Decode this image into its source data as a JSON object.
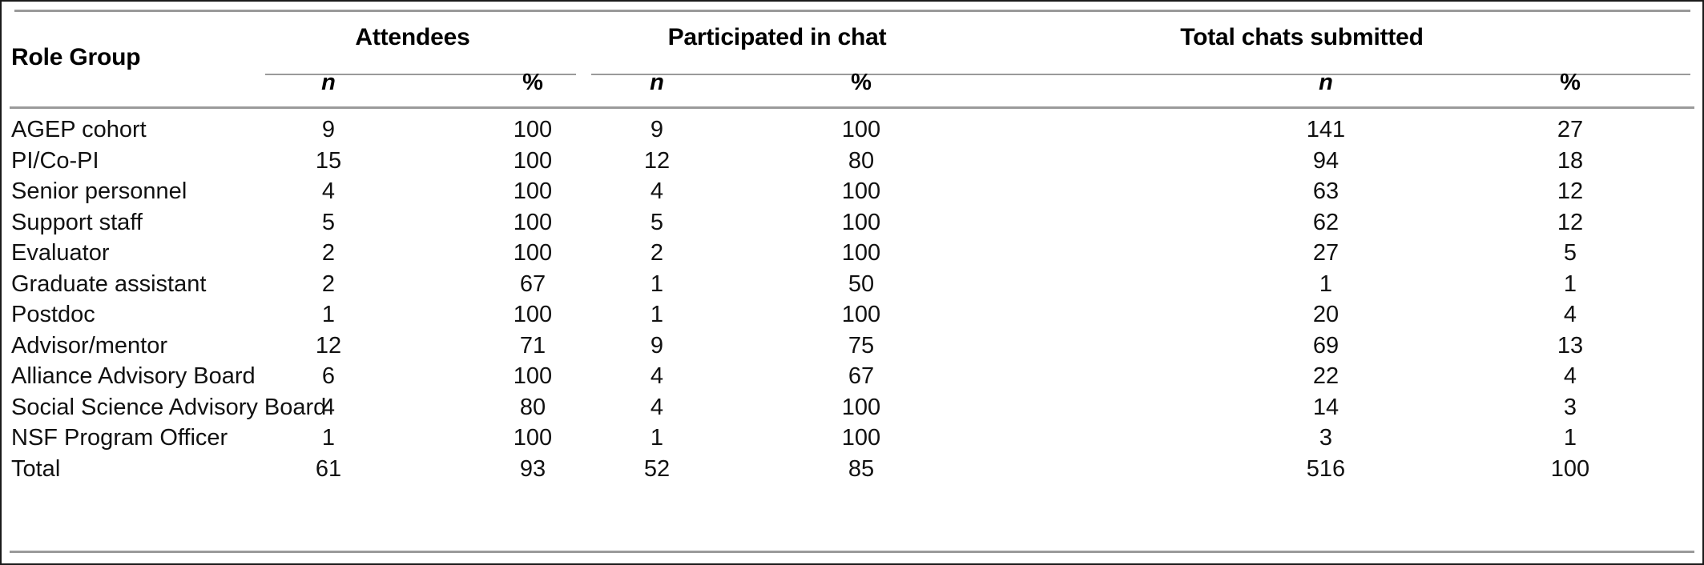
{
  "table": {
    "row_header_label": "Role Group",
    "column_groups": [
      {
        "title": "Attendees",
        "subcolumns": [
          "n",
          "%"
        ]
      },
      {
        "title": "Participated in chat",
        "subcolumns": [
          "n",
          "%"
        ]
      },
      {
        "title": "Total chats submitted",
        "subcolumns": [
          "n",
          "%"
        ]
      }
    ],
    "rows": [
      {
        "label": "AGEP cohort",
        "attendees_n": "9",
        "attendees_pct": "100",
        "chat_n": "9",
        "chat_pct": "100",
        "chats_n": "141",
        "chats_pct": "27"
      },
      {
        "label": "PI/Co-PI",
        "attendees_n": "15",
        "attendees_pct": "100",
        "chat_n": "12",
        "chat_pct": "80",
        "chats_n": "94",
        "chats_pct": "18"
      },
      {
        "label": "Senior personnel",
        "attendees_n": "4",
        "attendees_pct": "100",
        "chat_n": "4",
        "chat_pct": "100",
        "chats_n": "63",
        "chats_pct": "12"
      },
      {
        "label": "Support staff",
        "attendees_n": "5",
        "attendees_pct": "100",
        "chat_n": "5",
        "chat_pct": "100",
        "chats_n": "62",
        "chats_pct": "12"
      },
      {
        "label": "Evaluator",
        "attendees_n": "2",
        "attendees_pct": "100",
        "chat_n": "2",
        "chat_pct": "100",
        "chats_n": "27",
        "chats_pct": "5"
      },
      {
        "label": "Graduate assistant",
        "attendees_n": "2",
        "attendees_pct": "67",
        "chat_n": "1",
        "chat_pct": "50",
        "chats_n": "1",
        "chats_pct": "1"
      },
      {
        "label": "Postdoc",
        "attendees_n": "1",
        "attendees_pct": "100",
        "chat_n": "1",
        "chat_pct": "100",
        "chats_n": "20",
        "chats_pct": "4"
      },
      {
        "label": "Advisor/mentor",
        "attendees_n": "12",
        "attendees_pct": "71",
        "chat_n": "9",
        "chat_pct": "75",
        "chats_n": "69",
        "chats_pct": "13"
      },
      {
        "label": "Alliance Advisory Board",
        "attendees_n": "6",
        "attendees_pct": "100",
        "chat_n": "4",
        "chat_pct": "67",
        "chats_n": "22",
        "chats_pct": "4"
      },
      {
        "label": "Social Science Advisory Board",
        "attendees_n": "4",
        "attendees_pct": "80",
        "chat_n": "4",
        "chat_pct": "100",
        "chats_n": "14",
        "chats_pct": "3"
      },
      {
        "label": "NSF Program Officer",
        "attendees_n": "1",
        "attendees_pct": "100",
        "chat_n": "1",
        "chat_pct": "100",
        "chats_n": "3",
        "chats_pct": "1"
      },
      {
        "label": "Total",
        "attendees_n": "61",
        "attendees_pct": "93",
        "chat_n": "52",
        "chat_pct": "85",
        "chats_n": "516",
        "chats_pct": "100"
      }
    ]
  },
  "colors": {
    "rule": "#9a9a9a",
    "frame": "#1a1a1a",
    "text": "#111111"
  }
}
